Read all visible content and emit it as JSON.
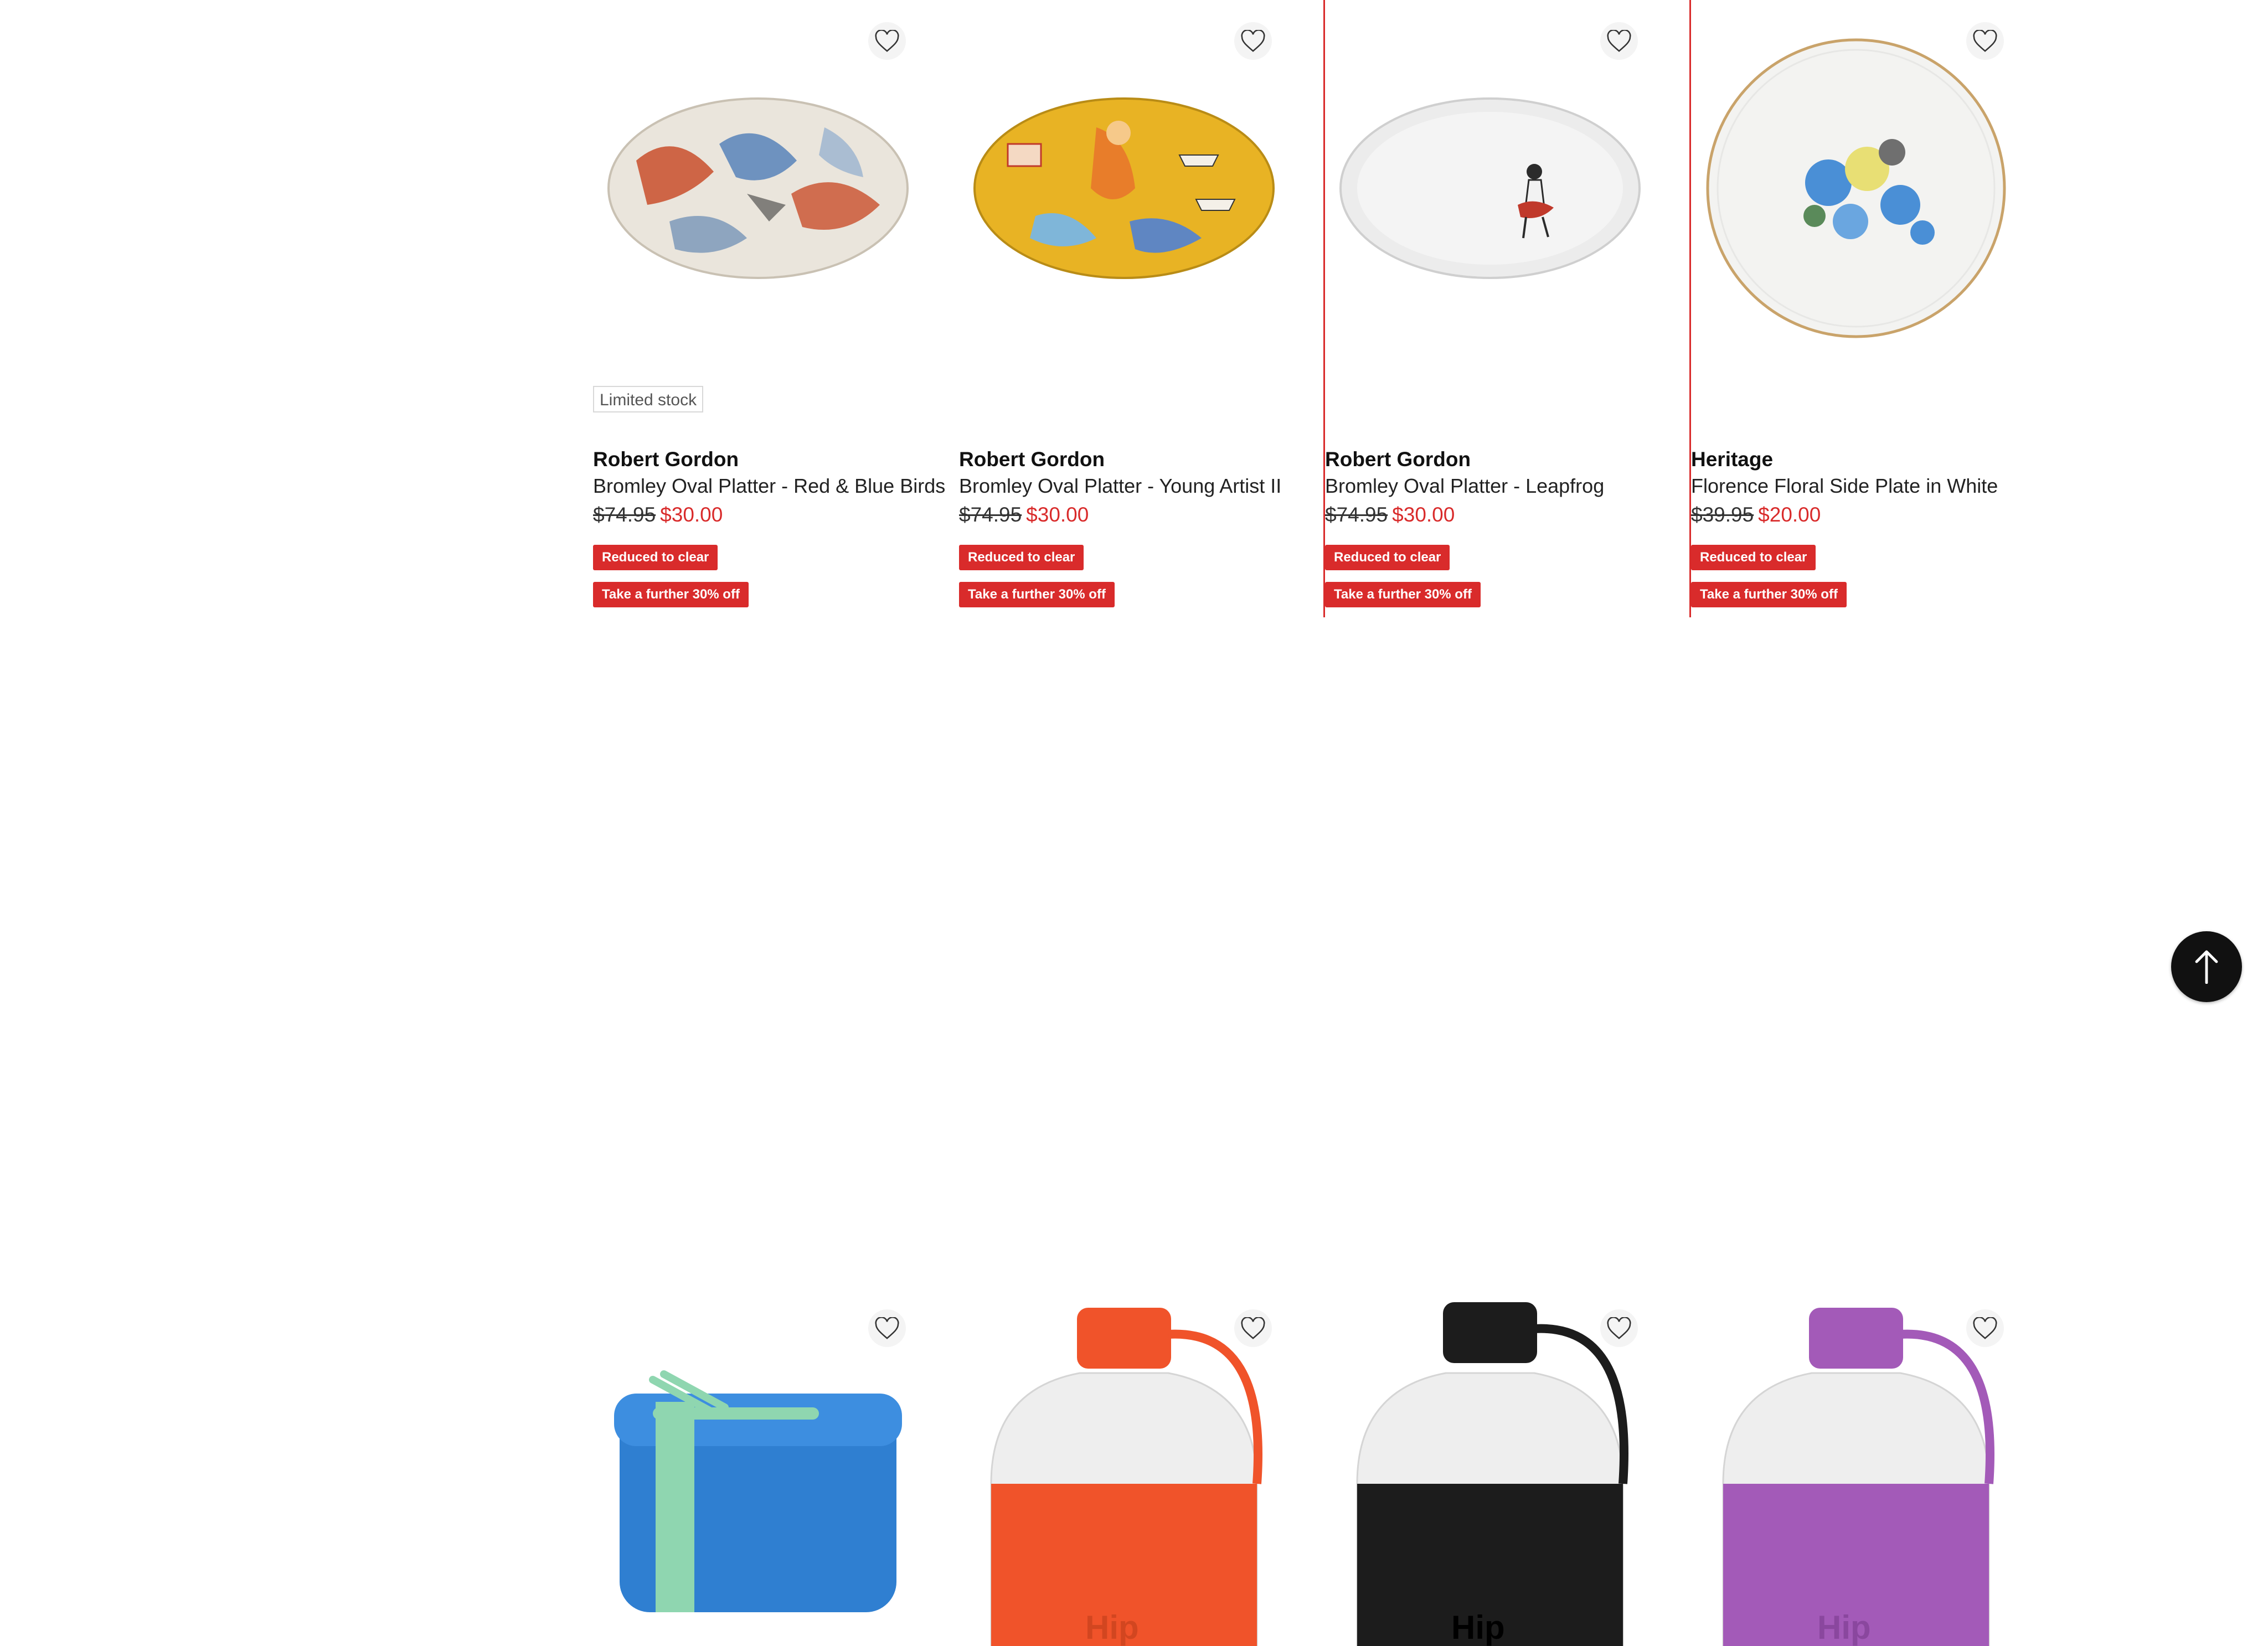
{
  "products": [
    {
      "brand": "Robert Gordon",
      "name": "Bromley Oval Platter - Red & Blue Birds",
      "was": "$74.95",
      "now": "$30.00",
      "badge": "Limited stock",
      "tags": [
        "Reduced to clear",
        "Take a further 30% off"
      ],
      "image": "oval-platter-birds"
    },
    {
      "brand": "Robert Gordon",
      "name": "Bromley Oval Platter - Young Artist II",
      "was": "$74.95",
      "now": "$30.00",
      "badge": "",
      "tags": [
        "Reduced to clear",
        "Take a further 30% off"
      ],
      "image": "oval-platter-yellow"
    },
    {
      "brand": "Robert Gordon",
      "name": "Bromley Oval Platter - Leapfrog",
      "was": "$74.95",
      "now": "$30.00",
      "badge": "",
      "tags": [
        "Reduced to clear",
        "Take a further 30% off"
      ],
      "image": "oval-platter-white"
    },
    {
      "brand": "Heritage",
      "name": "Florence Floral Side Plate in White",
      "was": "$39.95",
      "now": "$20.00",
      "badge": "",
      "tags": [
        "Reduced to clear",
        "Take a further 30% off"
      ],
      "image": "floral-plate"
    }
  ],
  "row2_images": [
    "blue-lunch-box",
    "orange-bottle",
    "black-bottle",
    "purple-bottle"
  ],
  "bottle_text": "Hip",
  "colors": {
    "accent": "#d92b2b",
    "bottle_orange": "#f0532a",
    "bottle_black": "#1c1c1c",
    "bottle_purple": "#a35ab8",
    "lunchbox_blue": "#2f7fd1"
  },
  "icons": {
    "wishlist": "heart-outline-icon",
    "back_to_top": "arrow-up-icon"
  }
}
